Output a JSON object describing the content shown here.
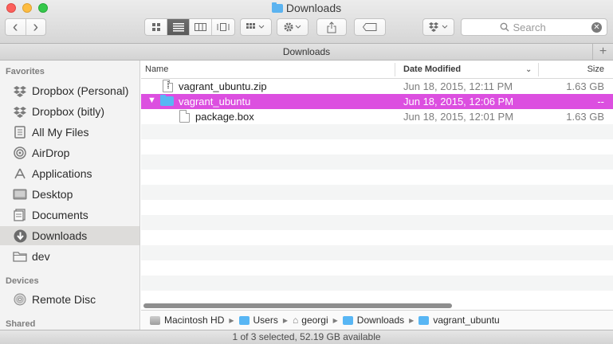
{
  "window": {
    "title": "Downloads"
  },
  "toolbar": {
    "back": "‹",
    "forward": "›",
    "search_placeholder": "Search"
  },
  "path_header": {
    "title": "Downloads",
    "add_label": "+"
  },
  "sidebar": {
    "favorites_label": "Favorites",
    "devices_label": "Devices",
    "shared_label": "Shared",
    "favorites": [
      {
        "label": "Dropbox (Personal)",
        "icon": "dropbox-icon"
      },
      {
        "label": "Dropbox (bitly)",
        "icon": "dropbox-icon"
      },
      {
        "label": "All My Files",
        "icon": "all-files-icon"
      },
      {
        "label": "AirDrop",
        "icon": "airdrop-icon"
      },
      {
        "label": "Applications",
        "icon": "applications-icon"
      },
      {
        "label": "Desktop",
        "icon": "desktop-icon"
      },
      {
        "label": "Documents",
        "icon": "documents-icon"
      },
      {
        "label": "Downloads",
        "icon": "downloads-icon",
        "selected": true
      },
      {
        "label": "dev",
        "icon": "folder-icon"
      }
    ],
    "devices": [
      {
        "label": "Remote Disc",
        "icon": "disc-icon"
      }
    ]
  },
  "columns": {
    "name": "Name",
    "date": "Date Modified",
    "size": "Size"
  },
  "files": [
    {
      "name": "vagrant_ubuntu.zip",
      "date": "Jun 18, 2015, 12:11 PM",
      "size": "1.63 GB",
      "kind": "zip"
    },
    {
      "name": "vagrant_ubuntu",
      "date": "Jun 18, 2015, 12:06 PM",
      "size": "--",
      "kind": "folder",
      "expanded": true,
      "selected": true
    },
    {
      "name": "package.box",
      "date": "Jun 18, 2015, 12:01 PM",
      "size": "1.63 GB",
      "kind": "file",
      "indent": true
    }
  ],
  "pathbar": [
    "Macintosh HD",
    "Users",
    "georgi",
    "Downloads",
    "vagrant_ubuntu"
  ],
  "status": {
    "text": "1 of 3 selected, 52.19 GB available"
  },
  "colors": {
    "selection": "#dc4fe0",
    "folder": "#58b6f4"
  }
}
